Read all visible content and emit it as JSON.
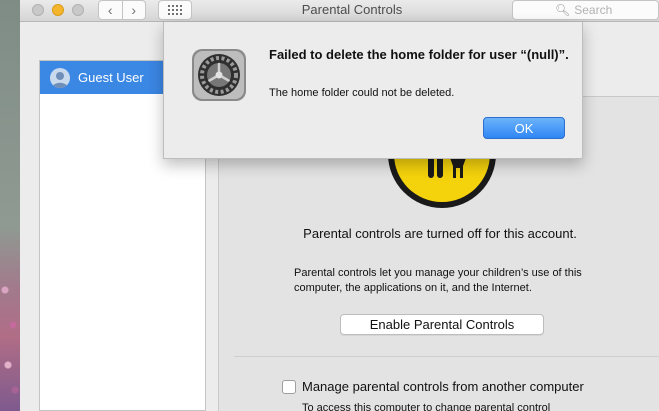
{
  "window": {
    "title": "Parental Controls",
    "search_placeholder": "Search"
  },
  "sidebar": {
    "items": [
      {
        "label": "Guest User",
        "selected": true
      }
    ]
  },
  "main": {
    "status_text": "Parental controls are turned off for this account.",
    "description": "Parental controls let you manage your children’s use of this computer, the applications on it, and the Internet.",
    "enable_button": "Enable Parental Controls",
    "remote_checkbox_label": "Manage parental controls from another computer",
    "remote_checkbox_checked": false,
    "remote_subtext": "To access this computer to change parental control"
  },
  "alert": {
    "title": "Failed to delete the home folder for user “(null)”.",
    "message": "The home folder could not be deleted.",
    "ok_button": "OK",
    "icon": "system-preferences-gear-icon"
  },
  "colors": {
    "accent": "#3b87e4",
    "ok_button": "#2f86f5",
    "parental_icon": "#f5d30c"
  }
}
